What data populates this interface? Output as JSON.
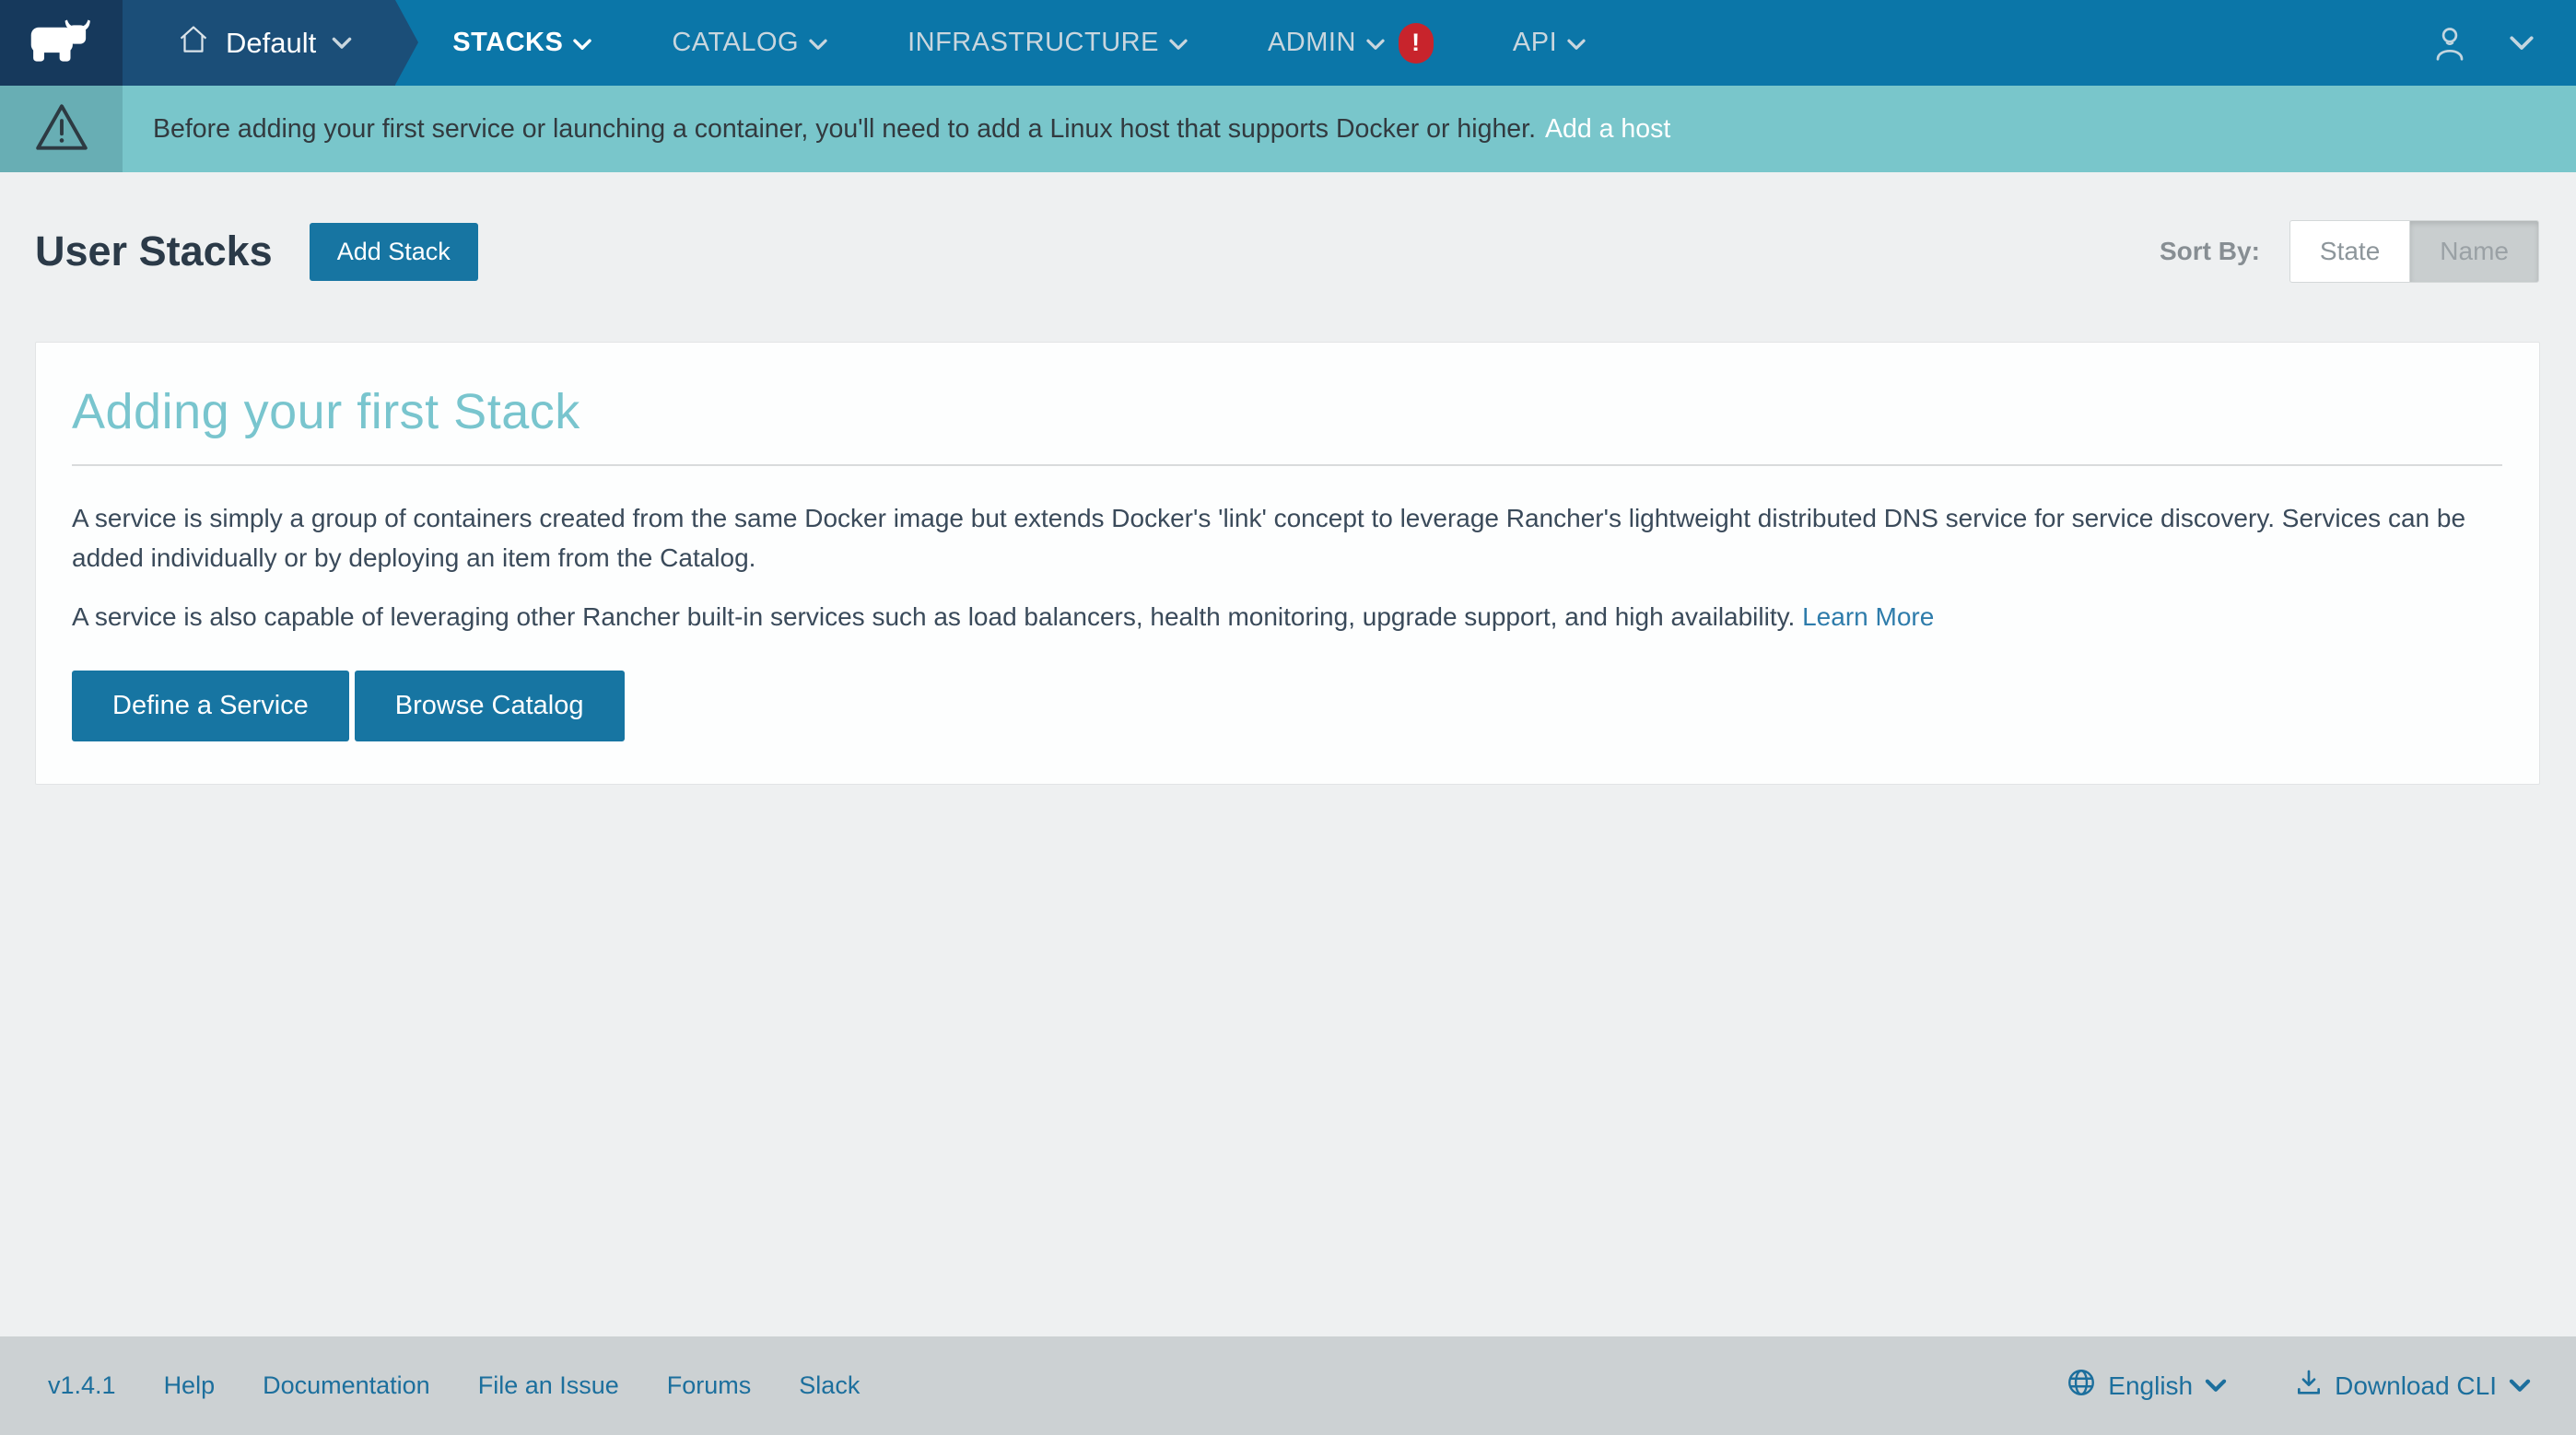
{
  "nav": {
    "environment": {
      "label": "Default"
    },
    "items": [
      {
        "label": "STACKS"
      },
      {
        "label": "CATALOG"
      },
      {
        "label": "INFRASTRUCTURE"
      },
      {
        "label": "ADMIN",
        "badge": "!"
      },
      {
        "label": "API"
      }
    ]
  },
  "banner": {
    "message": "Before adding your first service or launching a container, you'll need to add a Linux host that supports Docker or higher.",
    "link_label": "Add a host"
  },
  "page_header": {
    "title": "User Stacks",
    "add_button": "Add Stack",
    "sort_label": "Sort By:",
    "sort_state": "State",
    "sort_name": "Name"
  },
  "card": {
    "title": "Adding your first Stack",
    "paragraph1": "A service is simply a group of containers created from the same Docker image but extends Docker's 'link' concept to leverage Rancher's lightweight distributed DNS service for service discovery. Services can be added individually or by deploying an item from the Catalog.",
    "paragraph2": "A service is also capable of leveraging other Rancher built-in services such as load balancers, health monitoring, upgrade support, and high availability.",
    "learn_more": "Learn More",
    "define_button": "Define a Service",
    "browse_button": "Browse Catalog"
  },
  "footer": {
    "version": "v1.4.1",
    "links": [
      "Help",
      "Documentation",
      "File an Issue",
      "Forums",
      "Slack"
    ],
    "language": "English",
    "download_cli": "Download CLI"
  },
  "colors": {
    "nav_blue": "#0b76a8",
    "logo_navy": "#16395c",
    "env_navy": "#1b4e78",
    "banner_teal": "#79c6cb",
    "banner_icon_teal": "#68aeb4",
    "badge_red": "#c8242c",
    "accent_button_blue": "#1775a2",
    "card_title_teal": "#79c5ce",
    "link_blue": "#1c6f9d",
    "footer_gray": "#ccd1d3"
  }
}
